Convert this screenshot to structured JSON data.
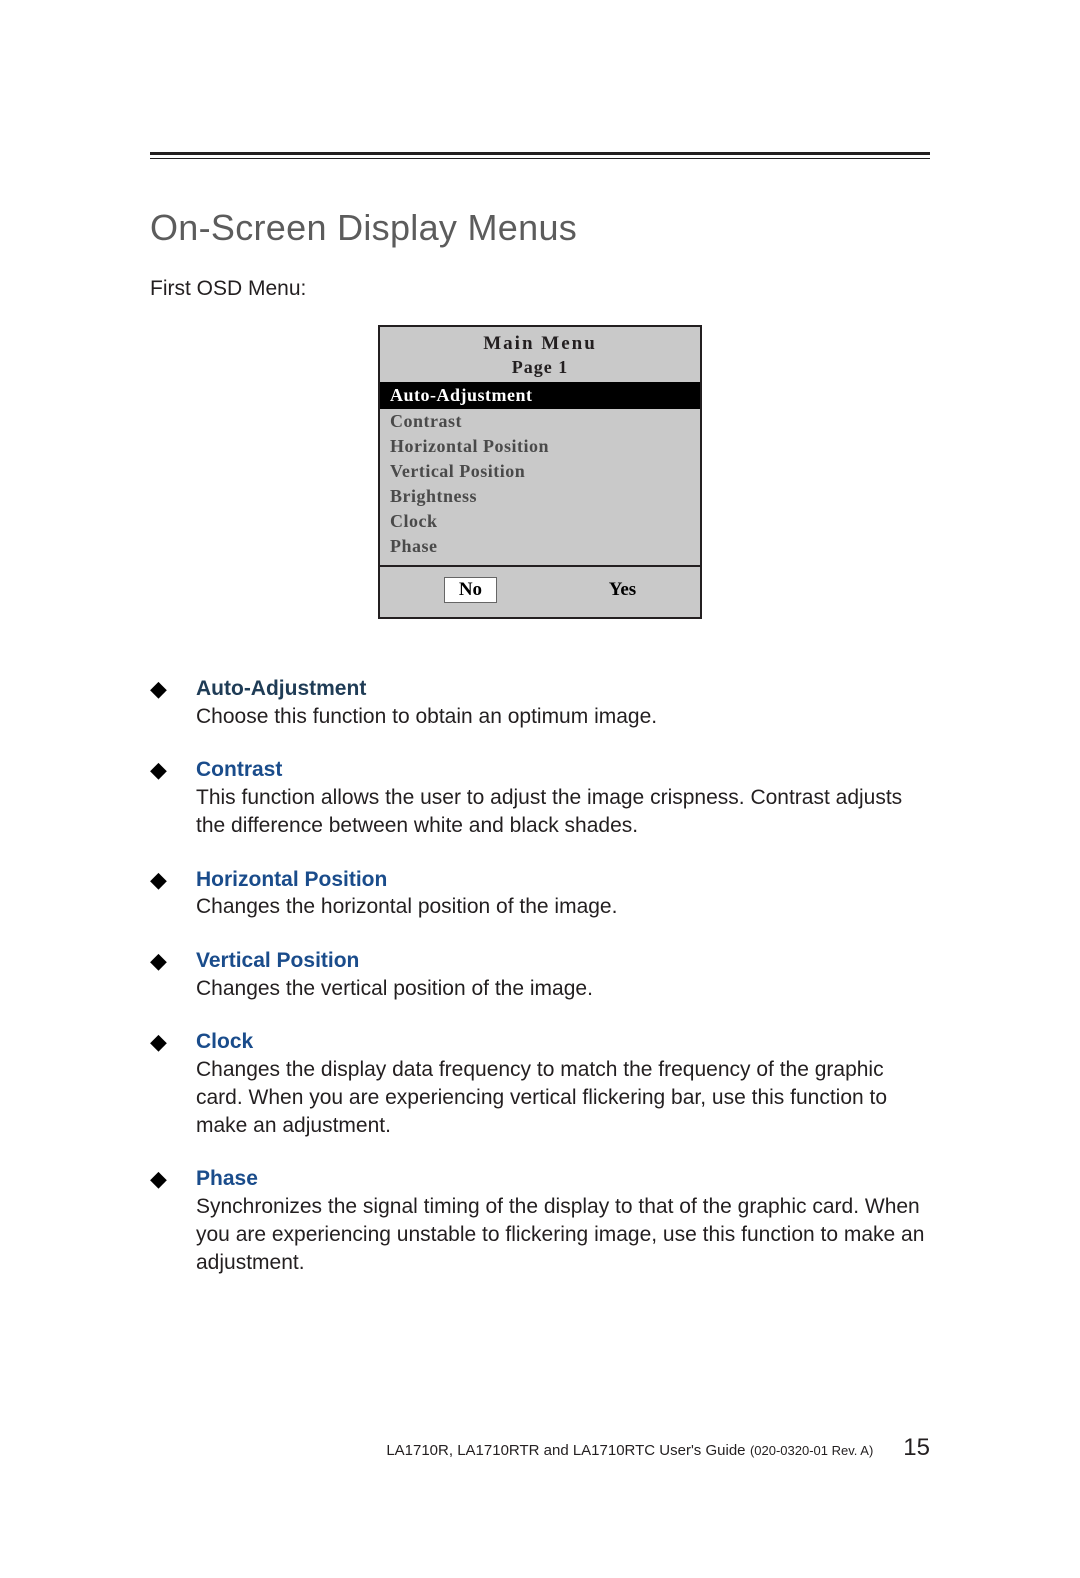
{
  "heading": "On-Screen Display Menus",
  "intro": "First OSD Menu:",
  "osd": {
    "title": "Main Menu",
    "page_label": "Page 1",
    "selected": "Auto-Adjustment",
    "items": [
      "Contrast",
      "Horizontal Position",
      "Vertical Position",
      "Brightness",
      "Clock",
      "Phase"
    ],
    "no_label": "No",
    "yes_label": "Yes"
  },
  "defs": [
    {
      "title": "Auto-Adjustment",
      "body": "Choose this function to obtain an optimum image."
    },
    {
      "title": "Contrast",
      "body": "This function allows the user to adjust the image crispness. Contrast adjusts the difference between white and black shades."
    },
    {
      "title": "Horizontal Position",
      "body": "Changes the horizontal position of the image."
    },
    {
      "title": "Vertical Position",
      "body": "Changes the vertical position of  the image."
    },
    {
      "title": "Clock",
      "body": "Changes the display data frequency to match the frequency of the graphic card. When you are experiencing vertical flickering bar, use this function to make an adjustment."
    },
    {
      "title": "Phase",
      "body": "Synchronizes the signal timing of the display to that of the graphic card. When you are experiencing unstable to flickering image, use this function to make an adjustment."
    }
  ],
  "footer": {
    "guide_name": "LA1710R, LA1710RTR and LA1710RTC User's Guide",
    "code": "(020-0320-01 Rev. A)",
    "page_no": "15"
  }
}
